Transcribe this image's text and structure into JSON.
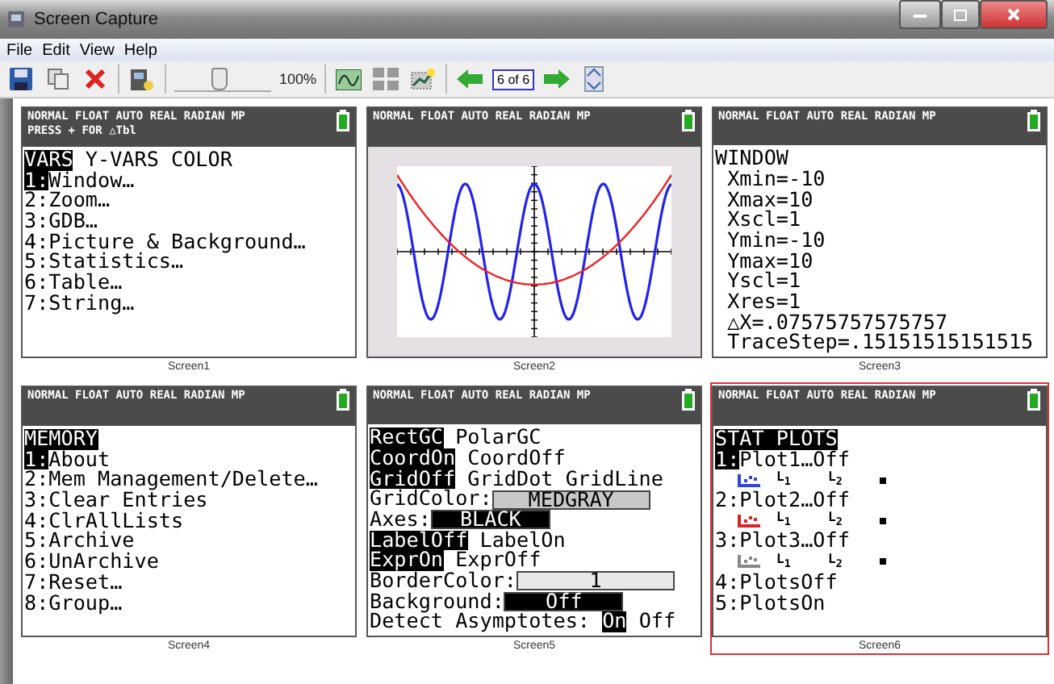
{
  "window": {
    "title": "Screen Capture"
  },
  "menu": [
    "File",
    "Edit",
    "View",
    "Help"
  ],
  "toolbar": {
    "zoom_slider": {
      "level": 0.45
    },
    "zoom": "100%",
    "page": "6 of 6"
  },
  "screens": [
    {
      "caption": "Screen1",
      "selected": false,
      "kind": "menu",
      "status": [
        "NORMAL FLOAT AUTO REAL RADIAN MP",
        "PRESS + FOR △Tbl"
      ],
      "lines": [
        {
          "kind": "text",
          "segments": [
            {
              "kind": "text",
              "text": "VARS",
              "highlighted": true
            },
            {
              "kind": "text",
              "text": " Y-VARS COLOR",
              "highlighted": false
            }
          ]
        },
        {
          "kind": "text",
          "segments": [
            {
              "kind": "text",
              "text": "1:",
              "highlighted": true
            },
            {
              "kind": "text",
              "text": "Window…",
              "highlighted": false
            }
          ]
        },
        {
          "kind": "text",
          "segments": [
            {
              "kind": "text",
              "text": "2:Zoom…",
              "highlighted": false
            }
          ]
        },
        {
          "kind": "text",
          "segments": [
            {
              "kind": "text",
              "text": "3:GDB…",
              "highlighted": false
            }
          ]
        },
        {
          "kind": "text",
          "segments": [
            {
              "kind": "text",
              "text": "4:Picture & Background…",
              "highlighted": false
            }
          ]
        },
        {
          "kind": "text",
          "segments": [
            {
              "kind": "text",
              "text": "5:Statistics…",
              "highlighted": false
            }
          ]
        },
        {
          "kind": "text",
          "segments": [
            {
              "kind": "text",
              "text": "6:Table…",
              "highlighted": false
            }
          ]
        },
        {
          "kind": "text",
          "segments": [
            {
              "kind": "text",
              "text": "7:String…",
              "highlighted": false
            }
          ]
        }
      ]
    },
    {
      "caption": "Screen2",
      "selected": false,
      "kind": "graph",
      "status": [
        "NORMAL FLOAT AUTO REAL RADIAN MP"
      ]
    },
    {
      "caption": "Screen3",
      "selected": false,
      "kind": "menu",
      "status": [
        "NORMAL FLOAT AUTO REAL RADIAN MP"
      ],
      "lines": [
        {
          "kind": "text",
          "segments": [
            {
              "kind": "text",
              "text": "WINDOW",
              "highlighted": false
            }
          ]
        },
        {
          "kind": "text",
          "segments": [
            {
              "kind": "text",
              "text": " Xmin=-10",
              "highlighted": false
            }
          ]
        },
        {
          "kind": "text",
          "segments": [
            {
              "kind": "text",
              "text": " Xmax=10",
              "highlighted": false
            }
          ]
        },
        {
          "kind": "text",
          "segments": [
            {
              "kind": "text",
              "text": " Xscl=1",
              "highlighted": false
            }
          ]
        },
        {
          "kind": "text",
          "segments": [
            {
              "kind": "text",
              "text": " Ymin=-10",
              "highlighted": false
            }
          ]
        },
        {
          "kind": "text",
          "segments": [
            {
              "kind": "text",
              "text": " Ymax=10",
              "highlighted": false
            }
          ]
        },
        {
          "kind": "text",
          "segments": [
            {
              "kind": "text",
              "text": " Yscl=1",
              "highlighted": false
            }
          ]
        },
        {
          "kind": "text",
          "segments": [
            {
              "kind": "text",
              "text": " Xres=1",
              "highlighted": false
            }
          ]
        },
        {
          "kind": "text",
          "segments": [
            {
              "kind": "text",
              "text": " △X=.07575757575757",
              "highlighted": false
            }
          ]
        },
        {
          "kind": "text",
          "segments": [
            {
              "kind": "text",
              "text": " TraceStep=.15151515151515",
              "highlighted": false
            }
          ]
        }
      ]
    },
    {
      "caption": "Screen4",
      "selected": false,
      "kind": "menu",
      "status": [
        "NORMAL FLOAT AUTO REAL RADIAN MP"
      ],
      "lines": [
        {
          "kind": "text",
          "segments": [
            {
              "kind": "text",
              "text": "MEMORY",
              "highlighted": true
            }
          ]
        },
        {
          "kind": "text",
          "segments": [
            {
              "kind": "text",
              "text": "1:",
              "highlighted": true
            },
            {
              "kind": "text",
              "text": "About",
              "highlighted": false
            }
          ]
        },
        {
          "kind": "text",
          "segments": [
            {
              "kind": "text",
              "text": "2:Mem Management/Delete…",
              "highlighted": false
            }
          ]
        },
        {
          "kind": "text",
          "segments": [
            {
              "kind": "text",
              "text": "3:Clear Entries",
              "highlighted": false
            }
          ]
        },
        {
          "kind": "text",
          "segments": [
            {
              "kind": "text",
              "text": "4:ClrAllLists",
              "highlighted": false
            }
          ]
        },
        {
          "kind": "text",
          "segments": [
            {
              "kind": "text",
              "text": "5:Archive",
              "highlighted": false
            }
          ]
        },
        {
          "kind": "text",
          "segments": [
            {
              "kind": "text",
              "text": "6:UnArchive",
              "highlighted": false
            }
          ]
        },
        {
          "kind": "text",
          "segments": [
            {
              "kind": "text",
              "text": "7:Reset…",
              "highlighted": false
            }
          ]
        },
        {
          "kind": "text",
          "segments": [
            {
              "kind": "text",
              "text": "8:Group…",
              "highlighted": false
            }
          ]
        }
      ]
    },
    {
      "caption": "Screen5",
      "selected": false,
      "kind": "menu",
      "status": [
        "NORMAL FLOAT AUTO REAL RADIAN MP"
      ],
      "lines": [
        {
          "kind": "text",
          "segments": [
            {
              "kind": "text",
              "text": "RectGC",
              "highlighted": true
            },
            {
              "kind": "text",
              "text": " PolarGC",
              "highlighted": false
            }
          ]
        },
        {
          "kind": "text",
          "segments": [
            {
              "kind": "text",
              "text": "CoordOn",
              "highlighted": true
            },
            {
              "kind": "text",
              "text": " CoordOff",
              "highlighted": false
            }
          ]
        },
        {
          "kind": "text",
          "segments": [
            {
              "kind": "text",
              "text": "GridOff",
              "highlighted": true
            },
            {
              "kind": "text",
              "text": " GridDot GridLine",
              "highlighted": false
            }
          ]
        },
        {
          "kind": "text",
          "segments": [
            {
              "kind": "text",
              "text": "GridColor:",
              "highlighted": false
            },
            {
              "kind": "field",
              "text": "MEDGRAY",
              "color": "#c8c8c8"
            }
          ]
        },
        {
          "kind": "text",
          "segments": [
            {
              "kind": "text",
              "text": "Axes:",
              "highlighted": false
            },
            {
              "kind": "field",
              "text": "BLACK",
              "color": "#000000"
            }
          ]
        },
        {
          "kind": "text",
          "segments": [
            {
              "kind": "text",
              "text": "LabelOff",
              "highlighted": true
            },
            {
              "kind": "text",
              "text": " LabelOn",
              "highlighted": false
            }
          ]
        },
        {
          "kind": "text",
          "segments": [
            {
              "kind": "text",
              "text": "ExprOn",
              "highlighted": true
            },
            {
              "kind": "text",
              "text": " ExprOff",
              "highlighted": false
            }
          ]
        },
        {
          "kind": "text",
          "segments": [
            {
              "kind": "text",
              "text": "BorderColor:",
              "highlighted": false
            },
            {
              "kind": "field",
              "text": "1",
              "color": "#e8e8e8"
            }
          ]
        },
        {
          "kind": "text",
          "segments": [
            {
              "kind": "text",
              "text": "Background:",
              "highlighted": false
            },
            {
              "kind": "field",
              "text": "Off",
              "color": "#000000"
            }
          ]
        },
        {
          "kind": "text",
          "segments": [
            {
              "kind": "text",
              "text": "Detect Asymptotes: ",
              "highlighted": false
            },
            {
              "kind": "text",
              "text": "On",
              "highlighted": true
            },
            {
              "kind": "text",
              "text": " Off",
              "highlighted": false
            }
          ]
        }
      ]
    },
    {
      "caption": "Screen6",
      "selected": true,
      "kind": "menu",
      "status": [
        "NORMAL FLOAT AUTO REAL RADIAN MP"
      ],
      "lines": [
        {
          "kind": "text",
          "segments": [
            {
              "kind": "text",
              "text": "STAT PLOTS",
              "highlighted": true
            }
          ]
        },
        {
          "kind": "text",
          "segments": [
            {
              "kind": "text",
              "text": "1:",
              "highlighted": true
            },
            {
              "kind": "text",
              "text": "Plot1…Off",
              "highlighted": false
            }
          ]
        },
        {
          "kind": "plot",
          "color": "#3344dd",
          "labels": [
            "L$_{1}$",
            "L$_{2}$"
          ]
        },
        {
          "kind": "text",
          "segments": [
            {
              "kind": "text",
              "text": "2:Plot2…Off",
              "highlighted": false
            }
          ]
        },
        {
          "kind": "plot",
          "color": "#dd2222",
          "labels": [
            "L$_{1}$",
            "L$_{2}$"
          ]
        },
        {
          "kind": "text",
          "segments": [
            {
              "kind": "text",
              "text": "3:Plot3…Off",
              "highlighted": false
            }
          ]
        },
        {
          "kind": "plot",
          "color": "#888888",
          "labels": [
            "L$_{1}$",
            "L$_{2}$"
          ]
        },
        {
          "kind": "text",
          "segments": [
            {
              "kind": "text",
              "text": "4:PlotsOff",
              "highlighted": false
            }
          ]
        },
        {
          "kind": "text",
          "segments": [
            {
              "kind": "text",
              "text": "5:PlotsOn",
              "highlighted": false
            }
          ]
        }
      ]
    }
  ]
}
